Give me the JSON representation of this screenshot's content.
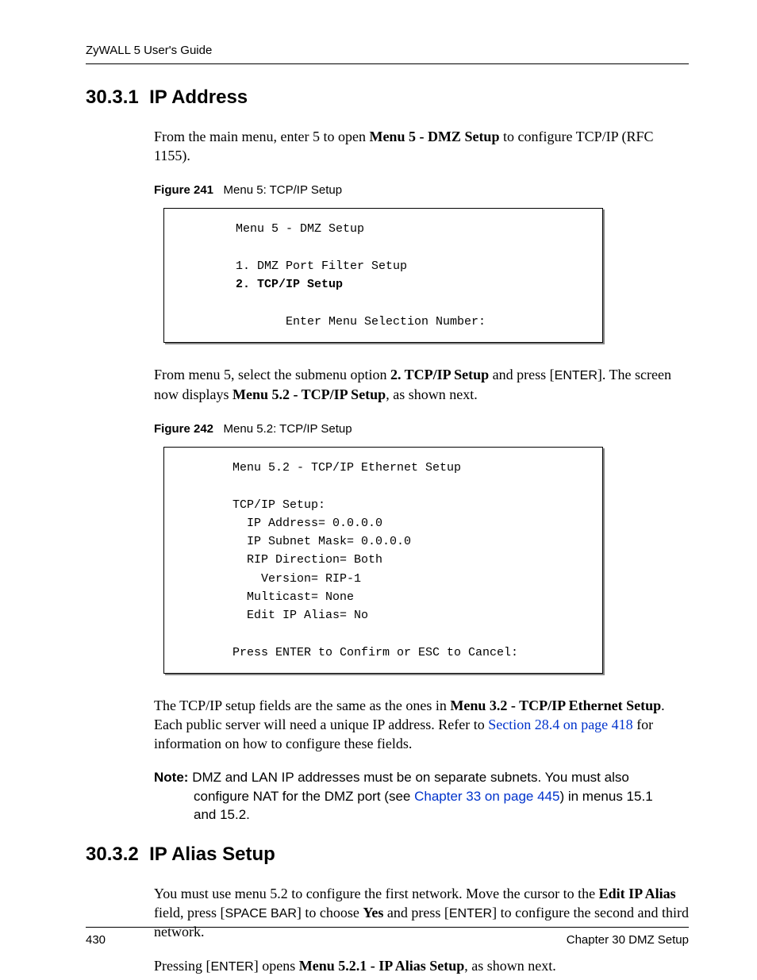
{
  "header": {
    "running_head": "ZyWALL 5 User's Guide"
  },
  "s1": {
    "number": "30.3.1",
    "title": "IP Address",
    "para1_pre": "From the main menu, enter 5 to open ",
    "para1_bold": "Menu 5 - DMZ Setup",
    "para1_post": " to configure TCP/IP (RFC 1155).",
    "fig1": {
      "label": "Figure 241",
      "caption": "Menu 5: TCP/IP Setup",
      "line_title": "Menu 5 - DMZ Setup",
      "line_item1": "1. DMZ Port Filter Setup",
      "line_item2": "2. TCP/IP Setup",
      "line_prompt": "Enter Menu Selection Number:"
    },
    "para2_a": "From menu 5, select the submenu option ",
    "para2_b": "2. TCP/IP Setup",
    "para2_c": " and press [",
    "para2_key": "ENTER",
    "para2_d": "]. The screen now displays ",
    "para2_e": "Menu 5.2 - TCP/IP Setup",
    "para2_f": ", as shown next.",
    "fig2": {
      "label": "Figure 242",
      "caption": "Menu 5.2: TCP/IP Setup",
      "l1": "Menu 5.2 - TCP/IP Ethernet Setup",
      "l2": "TCP/IP Setup:",
      "l3": "  IP Address= 0.0.0.0",
      "l4": "  IP Subnet Mask= 0.0.0.0",
      "l5": "  RIP Direction= Both",
      "l6": "    Version= RIP-1",
      "l7": "  Multicast= None",
      "l8": "  Edit IP Alias= No",
      "l9": "Press ENTER to Confirm or ESC to Cancel:"
    },
    "para3_a": "The TCP/IP setup fields are the same as the ones in ",
    "para3_b": "Menu 3.2 - TCP/IP Ethernet Setup",
    "para3_c": ". Each public server will need a unique IP address. Refer to ",
    "para3_link": "Section 28.4 on page 418",
    "para3_d": " for information on how to configure these fields.",
    "note": {
      "label": "Note:",
      "line1": "DMZ and LAN IP addresses must be on separate subnets. You must also",
      "line2a": "configure NAT for the DMZ port (see ",
      "line2_link": "Chapter 33 on page 445",
      "line2b": ") in menus 15.1",
      "line3": "and 15.2."
    }
  },
  "s2": {
    "number": "30.3.2",
    "title": "IP Alias Setup",
    "para1_a": "You must use menu 5.2 to configure the first network. Move the cursor to the ",
    "para1_b": "Edit IP Alias",
    "para1_c": " field, press [",
    "para1_key1": "SPACE BAR",
    "para1_d": "] to choose ",
    "para1_e": "Yes",
    "para1_f": " and press [",
    "para1_key2": "ENTER",
    "para1_g": "] to configure the second and third network.",
    "para2_a": "Pressing [",
    "para2_key": "ENTER",
    "para2_b": "] opens ",
    "para2_c": "Menu 5.2.1 - IP Alias Setup",
    "para2_d": ", as shown next."
  },
  "footer": {
    "page": "430",
    "chapter": "Chapter 30 DMZ Setup"
  }
}
